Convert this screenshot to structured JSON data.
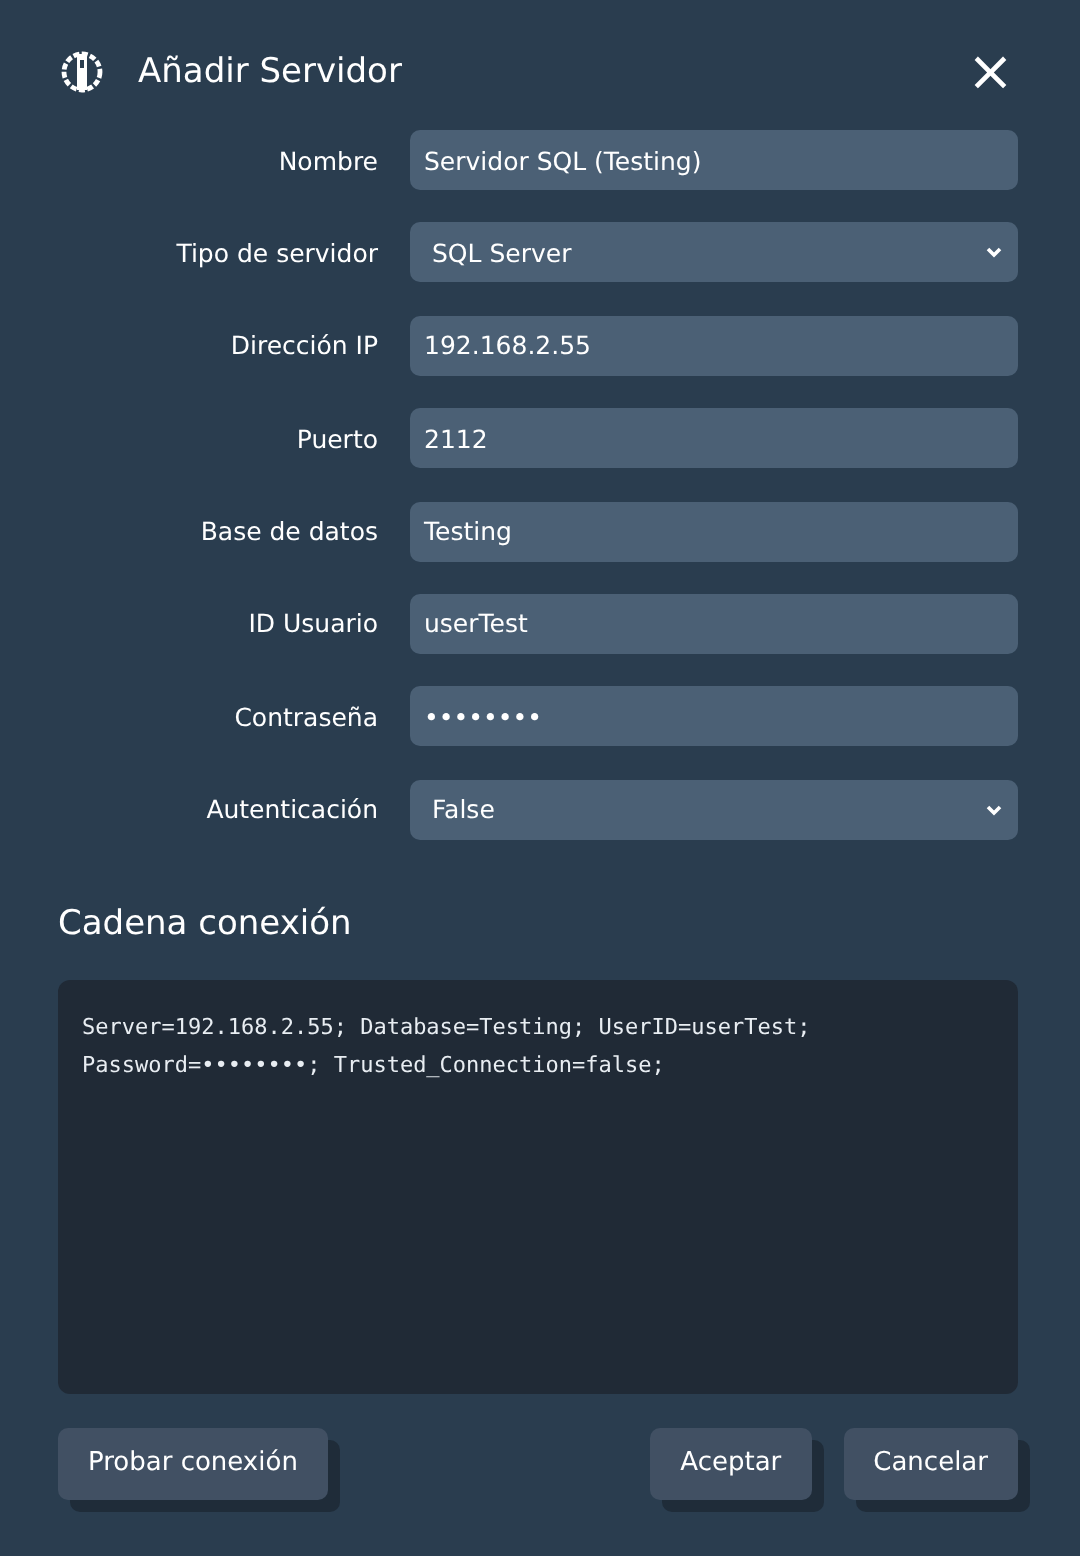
{
  "dialog": {
    "title": "Añadir Servidor",
    "close": "×"
  },
  "fields": [
    {
      "label": "Nombre",
      "kind": "text",
      "value": "Servidor SQL (Testing)"
    },
    {
      "label": "Tipo de servidor",
      "kind": "select",
      "value": "SQL Server"
    },
    {
      "label": "Dirección IP",
      "kind": "text",
      "value": "192.168.2.55"
    },
    {
      "label": "Puerto",
      "kind": "text",
      "value": "2112"
    },
    {
      "label": "Base de datos",
      "kind": "text",
      "value": "Testing"
    },
    {
      "label": "ID Usuario",
      "kind": "text",
      "value": "userTest"
    },
    {
      "label": "Contraseña",
      "kind": "password",
      "value": "••••••••"
    },
    {
      "label": "Autenticación",
      "kind": "select",
      "value": "False"
    }
  ],
  "connection_string": {
    "heading": "Cadena conexión",
    "lines": [
      "Server=192.168.2.55; Database=Testing; UserID=userTest;",
      "Password=••••••••; Trusted_Connection=false;"
    ]
  },
  "left_buttons": [
    "Probar conexión"
  ],
  "right_buttons": [
    "Aceptar",
    "Cancelar"
  ]
}
